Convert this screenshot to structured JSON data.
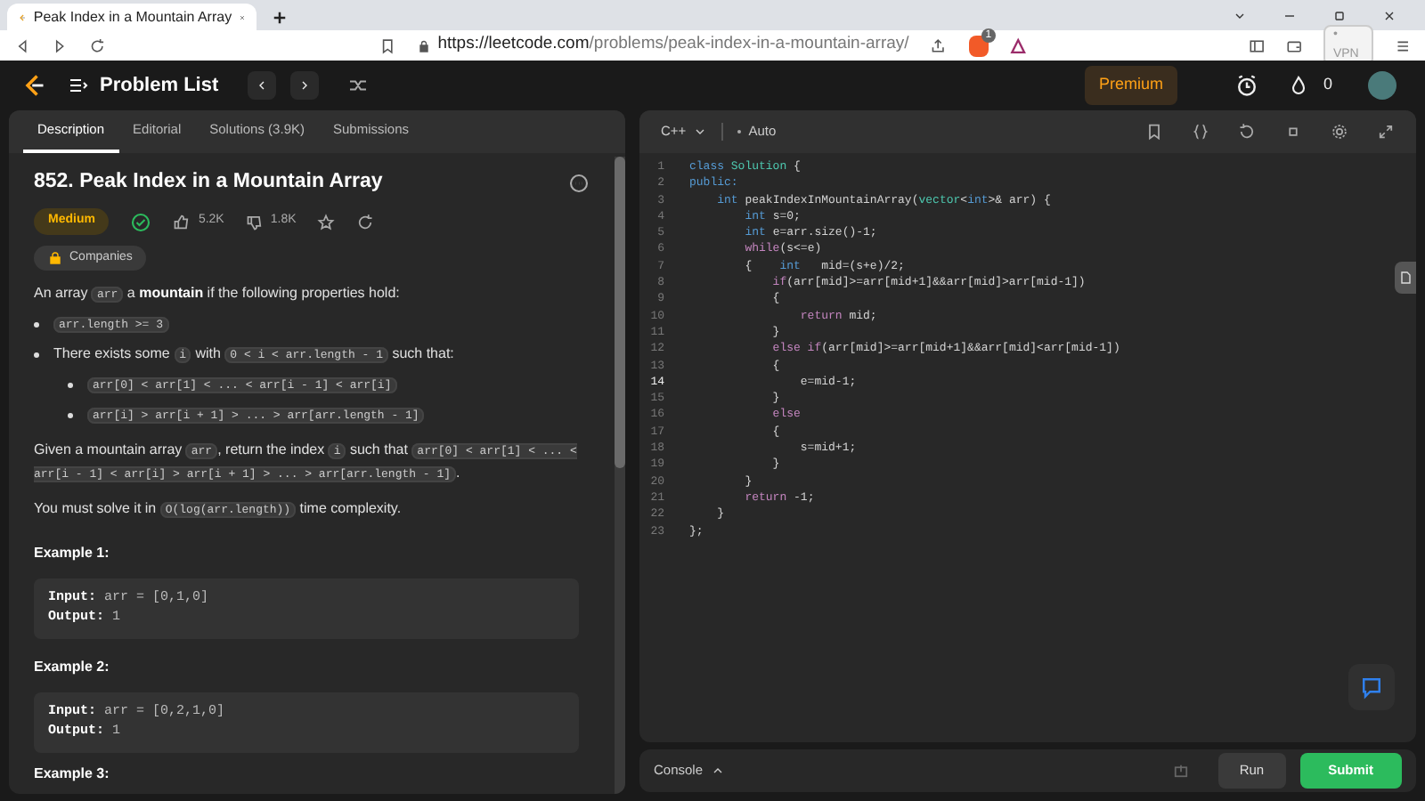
{
  "browser": {
    "tab_title": "Peak Index in a Mountain Array",
    "url_host": "https://leetcode.com",
    "url_path": "/problems/peak-index-in-a-mountain-array/",
    "vpn": "• VPN",
    "shield_count": "1"
  },
  "nav": {
    "problem_list": "Problem List",
    "premium": "Premium",
    "streak": "0"
  },
  "left_tabs": [
    {
      "label": "Description",
      "selected": true
    },
    {
      "label": "Editorial",
      "selected": false
    },
    {
      "label": "Solutions (3.9K)",
      "selected": false
    },
    {
      "label": "Submissions",
      "selected": false
    }
  ],
  "problem": {
    "title": "852. Peak Index in a Mountain Array",
    "difficulty": "Medium",
    "solved": true,
    "likes": "5.2K",
    "dislikes": "1.8K",
    "companies": "Companies",
    "body": [
      {
        "kind": "para",
        "segs": [
          {
            "kind": "text",
            "text": "An array "
          },
          {
            "kind": "code",
            "text": "arr"
          },
          {
            "kind": "text",
            "text": " a "
          },
          {
            "kind": "bold",
            "text": "mountain"
          },
          {
            "kind": "text",
            "text": " if the following properties hold:"
          }
        ]
      },
      {
        "kind": "bullet",
        "segs": [
          {
            "kind": "code",
            "text": "arr.length >= 3"
          }
        ]
      },
      {
        "kind": "bullet",
        "segs": [
          {
            "kind": "text",
            "text": "There exists some "
          },
          {
            "kind": "code",
            "text": "i"
          },
          {
            "kind": "text",
            "text": " with "
          },
          {
            "kind": "code",
            "text": "0 < i < arr.length - 1"
          },
          {
            "kind": "text",
            "text": " such that:"
          }
        ],
        "children": [
          {
            "kind": "bullet",
            "segs": [
              {
                "kind": "code",
                "text": "arr[0] < arr[1] < ... < arr[i - 1] < arr[i]"
              }
            ]
          },
          {
            "kind": "bullet",
            "segs": [
              {
                "kind": "code",
                "text": "arr[i] > arr[i + 1] > ... > arr[arr.length - 1]"
              }
            ]
          }
        ]
      },
      {
        "kind": "para",
        "segs": [
          {
            "kind": "text",
            "text": "Given a mountain array "
          },
          {
            "kind": "code",
            "text": "arr"
          },
          {
            "kind": "text",
            "text": ", return the index "
          },
          {
            "kind": "code",
            "text": "i"
          },
          {
            "kind": "text",
            "text": " such that "
          },
          {
            "kind": "code",
            "text": "arr[0] < arr[1] < ... < arr[i - 1] < arr[i] > arr[i + 1] > ... > arr[arr.length - 1]"
          },
          {
            "kind": "text",
            "text": "."
          }
        ]
      },
      {
        "kind": "para",
        "segs": [
          {
            "kind": "text",
            "text": "You must solve it in "
          },
          {
            "kind": "code",
            "text": "O(log(arr.length))"
          },
          {
            "kind": "text",
            "text": " time complexity."
          }
        ]
      }
    ],
    "examples": [
      {
        "title": "Example 1:",
        "input_label": "Input:",
        "input": "arr = [0,1,0]",
        "output_label": "Output:",
        "output": "1"
      },
      {
        "title": "Example 2:",
        "input_label": "Input:",
        "input": "arr = [0,2,1,0]",
        "output_label": "Output:",
        "output": "1"
      }
    ],
    "next_example_title": "Example 3:"
  },
  "editor": {
    "language": "C++",
    "mode": "Auto",
    "lines": [
      {
        "number": "1",
        "current": false,
        "tokens": [
          {
            "kind": "keyword",
            "text": "class "
          },
          {
            "kind": "type",
            "text": "Solution"
          },
          {
            "kind": "plain",
            "text": " {"
          }
        ]
      },
      {
        "number": "2",
        "current": false,
        "tokens": [
          {
            "kind": "keyword",
            "text": "public:"
          }
        ]
      },
      {
        "number": "3",
        "current": false,
        "tokens": [
          {
            "kind": "keyword",
            "text": "    int "
          },
          {
            "kind": "plain",
            "text": "peakIndexInMountainArray("
          },
          {
            "kind": "type",
            "text": "vector"
          },
          {
            "kind": "plain",
            "text": "<"
          },
          {
            "kind": "keyword",
            "text": "int"
          },
          {
            "kind": "plain",
            "text": ">& arr) {"
          }
        ]
      },
      {
        "number": "4",
        "current": false,
        "tokens": [
          {
            "kind": "keyword",
            "text": "        int "
          },
          {
            "kind": "plain",
            "text": "s=0;"
          }
        ]
      },
      {
        "number": "5",
        "current": false,
        "tokens": [
          {
            "kind": "keyword",
            "text": "        int "
          },
          {
            "kind": "plain",
            "text": "e=arr.size()-1;"
          }
        ]
      },
      {
        "number": "6",
        "current": false,
        "tokens": [
          {
            "kind": "control",
            "text": "        while"
          },
          {
            "kind": "plain",
            "text": "(s<=e)"
          }
        ]
      },
      {
        "number": "7",
        "current": false,
        "tokens": [
          {
            "kind": "plain",
            "text": "        {    "
          },
          {
            "kind": "keyword",
            "text": "int"
          },
          {
            "kind": "plain",
            "text": "   mid=(s+e)/2;"
          }
        ]
      },
      {
        "number": "8",
        "current": false,
        "tokens": [
          {
            "kind": "control",
            "text": "            if"
          },
          {
            "kind": "plain",
            "text": "(arr[mid]>=arr[mid+1]&&arr[mid]>arr[mid-1])"
          }
        ]
      },
      {
        "number": "9",
        "current": false,
        "tokens": [
          {
            "kind": "plain",
            "text": "            {"
          }
        ]
      },
      {
        "number": "10",
        "current": false,
        "tokens": [
          {
            "kind": "control",
            "text": "                return "
          },
          {
            "kind": "plain",
            "text": "mid;"
          }
        ]
      },
      {
        "number": "11",
        "current": false,
        "tokens": [
          {
            "kind": "plain",
            "text": "            }"
          }
        ]
      },
      {
        "number": "12",
        "current": false,
        "tokens": [
          {
            "kind": "control",
            "text": "            else if"
          },
          {
            "kind": "plain",
            "text": "(arr[mid]>=arr[mid+1]&&arr[mid]<arr[mid-1])"
          }
        ]
      },
      {
        "number": "13",
        "current": false,
        "tokens": [
          {
            "kind": "plain",
            "text": "            {"
          }
        ]
      },
      {
        "number": "14",
        "current": true,
        "tokens": [
          {
            "kind": "plain",
            "text": "                e=mid-1;"
          }
        ]
      },
      {
        "number": "15",
        "current": false,
        "tokens": [
          {
            "kind": "plain",
            "text": "            }"
          }
        ]
      },
      {
        "number": "16",
        "current": false,
        "tokens": [
          {
            "kind": "control",
            "text": "            else"
          }
        ]
      },
      {
        "number": "17",
        "current": false,
        "tokens": [
          {
            "kind": "plain",
            "text": "            {"
          }
        ]
      },
      {
        "number": "18",
        "current": false,
        "tokens": [
          {
            "kind": "plain",
            "text": "                s=mid+1;"
          }
        ]
      },
      {
        "number": "19",
        "current": false,
        "tokens": [
          {
            "kind": "plain",
            "text": "            }"
          }
        ]
      },
      {
        "number": "20",
        "current": false,
        "tokens": [
          {
            "kind": "plain",
            "text": "        }"
          }
        ]
      },
      {
        "number": "21",
        "current": false,
        "tokens": [
          {
            "kind": "control",
            "text": "        return "
          },
          {
            "kind": "plain",
            "text": "-1;"
          }
        ]
      },
      {
        "number": "22",
        "current": false,
        "tokens": [
          {
            "kind": "plain",
            "text": "    }"
          }
        ]
      },
      {
        "number": "23",
        "current": false,
        "tokens": [
          {
            "kind": "plain",
            "text": "};"
          }
        ]
      }
    ]
  },
  "console": {
    "label": "Console",
    "run": "Run",
    "submit": "Submit"
  }
}
